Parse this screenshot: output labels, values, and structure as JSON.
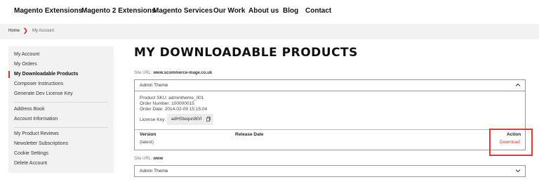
{
  "nav": {
    "items": [
      "Magento Extensions",
      "Magento 2 Extensions",
      "Magento Services",
      "Our Work",
      "About us",
      "Blog",
      "Contact"
    ]
  },
  "breadcrumb": {
    "home": "Home",
    "current": "My Account"
  },
  "sidebar": {
    "group1": [
      "My Account",
      "My Orders",
      "My Downloadable Products",
      "Composer Instructions",
      "Generate Dev License Key"
    ],
    "group2": [
      "Address Book",
      "Account Information"
    ],
    "group3": [
      "My Product Reviews",
      "Newsletter Subscriptions",
      "Cookie Settings",
      "Delete Account"
    ],
    "active_item": "My Downloadable Products"
  },
  "main": {
    "title": "MY DOWNLOADABLE PRODUCTS",
    "site1": {
      "label": "Site URL:",
      "url": "www.scommerce-mage.co.uk",
      "product": "Admin Theme",
      "sku_line": "Product SKU:  admintheme_001",
      "order_number_line": "Order Number:  100000015",
      "order_date_line": "Order Date:  2014-02-09 15:15:04",
      "license_label": "License Key:",
      "license_value": "adHStequn80/I",
      "table": {
        "headers": {
          "version": "Version",
          "release_date": "Release Date",
          "action": "Action"
        },
        "row": {
          "version": "(latest)",
          "release_date": "",
          "action": "Download"
        }
      }
    },
    "site2": {
      "label": "Site URL:",
      "url": "www",
      "product": "Admin Theme"
    }
  },
  "colors": {
    "accent": "#c0392b",
    "highlight_border": "#e53935",
    "sidebar_bg": "#f2f2f2"
  }
}
